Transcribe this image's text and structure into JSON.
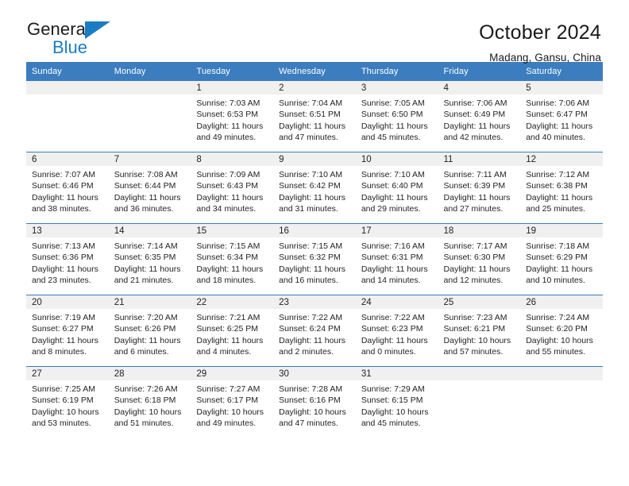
{
  "brand": {
    "name_top": "General",
    "name_bottom": "Blue",
    "accent_color": "#1a7dc4"
  },
  "header": {
    "title": "October 2024",
    "subtitle": "Madang, Gansu, China"
  },
  "theme": {
    "header_bar_color": "#3b7dbf",
    "daynum_band_color": "#f0f0f0",
    "text_color": "#232323"
  },
  "weekdays": [
    "Sunday",
    "Monday",
    "Tuesday",
    "Wednesday",
    "Thursday",
    "Friday",
    "Saturday"
  ],
  "weeks": [
    [
      {
        "day": "",
        "lines": []
      },
      {
        "day": "",
        "lines": []
      },
      {
        "day": "1",
        "lines": [
          "Sunrise: 7:03 AM",
          "Sunset: 6:53 PM",
          "Daylight: 11 hours",
          "and 49 minutes."
        ]
      },
      {
        "day": "2",
        "lines": [
          "Sunrise: 7:04 AM",
          "Sunset: 6:51 PM",
          "Daylight: 11 hours",
          "and 47 minutes."
        ]
      },
      {
        "day": "3",
        "lines": [
          "Sunrise: 7:05 AM",
          "Sunset: 6:50 PM",
          "Daylight: 11 hours",
          "and 45 minutes."
        ]
      },
      {
        "day": "4",
        "lines": [
          "Sunrise: 7:06 AM",
          "Sunset: 6:49 PM",
          "Daylight: 11 hours",
          "and 42 minutes."
        ]
      },
      {
        "day": "5",
        "lines": [
          "Sunrise: 7:06 AM",
          "Sunset: 6:47 PM",
          "Daylight: 11 hours",
          "and 40 minutes."
        ]
      }
    ],
    [
      {
        "day": "6",
        "lines": [
          "Sunrise: 7:07 AM",
          "Sunset: 6:46 PM",
          "Daylight: 11 hours",
          "and 38 minutes."
        ]
      },
      {
        "day": "7",
        "lines": [
          "Sunrise: 7:08 AM",
          "Sunset: 6:44 PM",
          "Daylight: 11 hours",
          "and 36 minutes."
        ]
      },
      {
        "day": "8",
        "lines": [
          "Sunrise: 7:09 AM",
          "Sunset: 6:43 PM",
          "Daylight: 11 hours",
          "and 34 minutes."
        ]
      },
      {
        "day": "9",
        "lines": [
          "Sunrise: 7:10 AM",
          "Sunset: 6:42 PM",
          "Daylight: 11 hours",
          "and 31 minutes."
        ]
      },
      {
        "day": "10",
        "lines": [
          "Sunrise: 7:10 AM",
          "Sunset: 6:40 PM",
          "Daylight: 11 hours",
          "and 29 minutes."
        ]
      },
      {
        "day": "11",
        "lines": [
          "Sunrise: 7:11 AM",
          "Sunset: 6:39 PM",
          "Daylight: 11 hours",
          "and 27 minutes."
        ]
      },
      {
        "day": "12",
        "lines": [
          "Sunrise: 7:12 AM",
          "Sunset: 6:38 PM",
          "Daylight: 11 hours",
          "and 25 minutes."
        ]
      }
    ],
    [
      {
        "day": "13",
        "lines": [
          "Sunrise: 7:13 AM",
          "Sunset: 6:36 PM",
          "Daylight: 11 hours",
          "and 23 minutes."
        ]
      },
      {
        "day": "14",
        "lines": [
          "Sunrise: 7:14 AM",
          "Sunset: 6:35 PM",
          "Daylight: 11 hours",
          "and 21 minutes."
        ]
      },
      {
        "day": "15",
        "lines": [
          "Sunrise: 7:15 AM",
          "Sunset: 6:34 PM",
          "Daylight: 11 hours",
          "and 18 minutes."
        ]
      },
      {
        "day": "16",
        "lines": [
          "Sunrise: 7:15 AM",
          "Sunset: 6:32 PM",
          "Daylight: 11 hours",
          "and 16 minutes."
        ]
      },
      {
        "day": "17",
        "lines": [
          "Sunrise: 7:16 AM",
          "Sunset: 6:31 PM",
          "Daylight: 11 hours",
          "and 14 minutes."
        ]
      },
      {
        "day": "18",
        "lines": [
          "Sunrise: 7:17 AM",
          "Sunset: 6:30 PM",
          "Daylight: 11 hours",
          "and 12 minutes."
        ]
      },
      {
        "day": "19",
        "lines": [
          "Sunrise: 7:18 AM",
          "Sunset: 6:29 PM",
          "Daylight: 11 hours",
          "and 10 minutes."
        ]
      }
    ],
    [
      {
        "day": "20",
        "lines": [
          "Sunrise: 7:19 AM",
          "Sunset: 6:27 PM",
          "Daylight: 11 hours",
          "and 8 minutes."
        ]
      },
      {
        "day": "21",
        "lines": [
          "Sunrise: 7:20 AM",
          "Sunset: 6:26 PM",
          "Daylight: 11 hours",
          "and 6 minutes."
        ]
      },
      {
        "day": "22",
        "lines": [
          "Sunrise: 7:21 AM",
          "Sunset: 6:25 PM",
          "Daylight: 11 hours",
          "and 4 minutes."
        ]
      },
      {
        "day": "23",
        "lines": [
          "Sunrise: 7:22 AM",
          "Sunset: 6:24 PM",
          "Daylight: 11 hours",
          "and 2 minutes."
        ]
      },
      {
        "day": "24",
        "lines": [
          "Sunrise: 7:22 AM",
          "Sunset: 6:23 PM",
          "Daylight: 11 hours",
          "and 0 minutes."
        ]
      },
      {
        "day": "25",
        "lines": [
          "Sunrise: 7:23 AM",
          "Sunset: 6:21 PM",
          "Daylight: 10 hours",
          "and 57 minutes."
        ]
      },
      {
        "day": "26",
        "lines": [
          "Sunrise: 7:24 AM",
          "Sunset: 6:20 PM",
          "Daylight: 10 hours",
          "and 55 minutes."
        ]
      }
    ],
    [
      {
        "day": "27",
        "lines": [
          "Sunrise: 7:25 AM",
          "Sunset: 6:19 PM",
          "Daylight: 10 hours",
          "and 53 minutes."
        ]
      },
      {
        "day": "28",
        "lines": [
          "Sunrise: 7:26 AM",
          "Sunset: 6:18 PM",
          "Daylight: 10 hours",
          "and 51 minutes."
        ]
      },
      {
        "day": "29",
        "lines": [
          "Sunrise: 7:27 AM",
          "Sunset: 6:17 PM",
          "Daylight: 10 hours",
          "and 49 minutes."
        ]
      },
      {
        "day": "30",
        "lines": [
          "Sunrise: 7:28 AM",
          "Sunset: 6:16 PM",
          "Daylight: 10 hours",
          "and 47 minutes."
        ]
      },
      {
        "day": "31",
        "lines": [
          "Sunrise: 7:29 AM",
          "Sunset: 6:15 PM",
          "Daylight: 10 hours",
          "and 45 minutes."
        ]
      },
      {
        "day": "",
        "lines": []
      },
      {
        "day": "",
        "lines": []
      }
    ]
  ]
}
